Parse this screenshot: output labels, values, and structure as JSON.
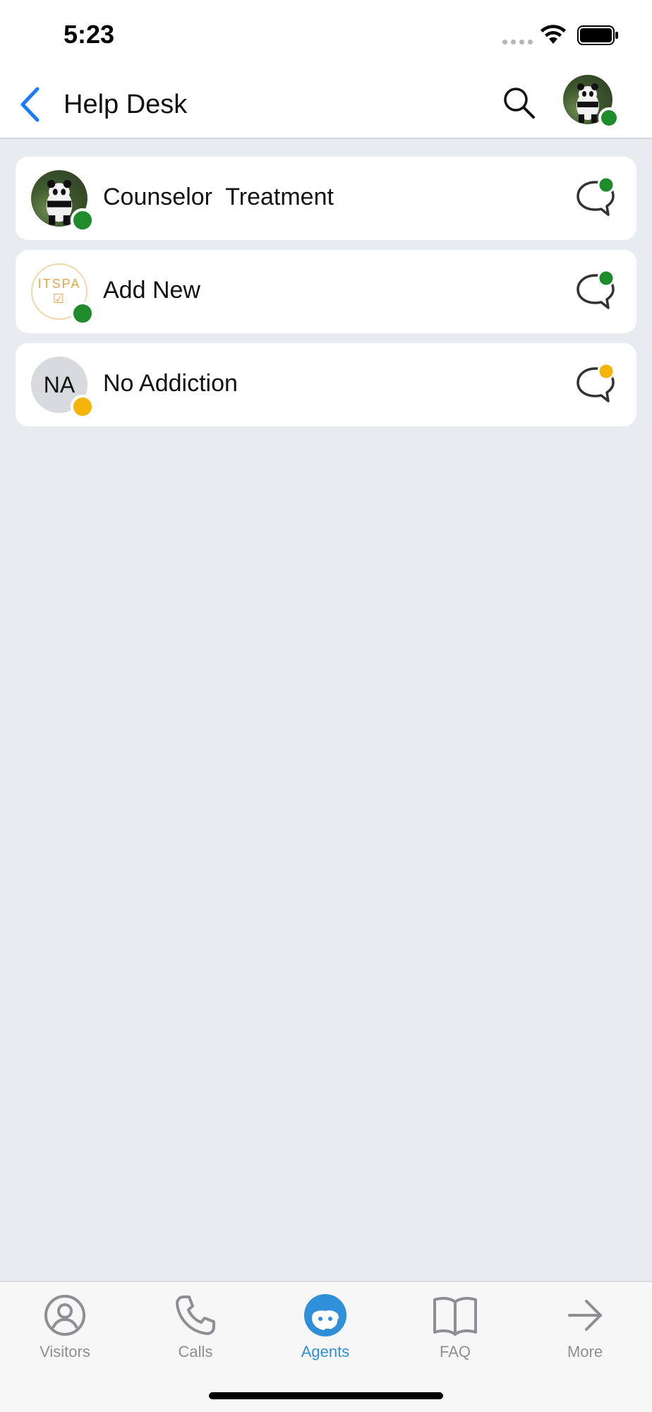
{
  "status_bar": {
    "time": "5:23"
  },
  "header": {
    "title": "Help Desk"
  },
  "agents": [
    {
      "name": "Counselor  Treatment",
      "avatar": "panda-photo",
      "status_color": "#1e8c2a"
    },
    {
      "name": "Add New",
      "avatar": "itspa-logo",
      "logo_text_top": "ITSPA",
      "logo_text_bottom": "☑",
      "status_color": "#1e8c2a"
    },
    {
      "name": "No Addiction",
      "avatar": "initials",
      "initials": "NA",
      "status_color": "#f5b40a"
    }
  ],
  "tabs": [
    {
      "label": "Visitors",
      "icon": "user-circle-icon"
    },
    {
      "label": "Calls",
      "icon": "phone-icon"
    },
    {
      "label": "Agents",
      "icon": "agent-headset-icon",
      "active": true
    },
    {
      "label": "FAQ",
      "icon": "book-icon"
    },
    {
      "label": "More",
      "icon": "arrow-right-icon"
    }
  ],
  "colors": {
    "accent": "#2f8fd8",
    "back_arrow": "#1a7cf5",
    "online": "#1e8c2a",
    "away": "#f5b40a",
    "background": "#e8ebf0"
  }
}
